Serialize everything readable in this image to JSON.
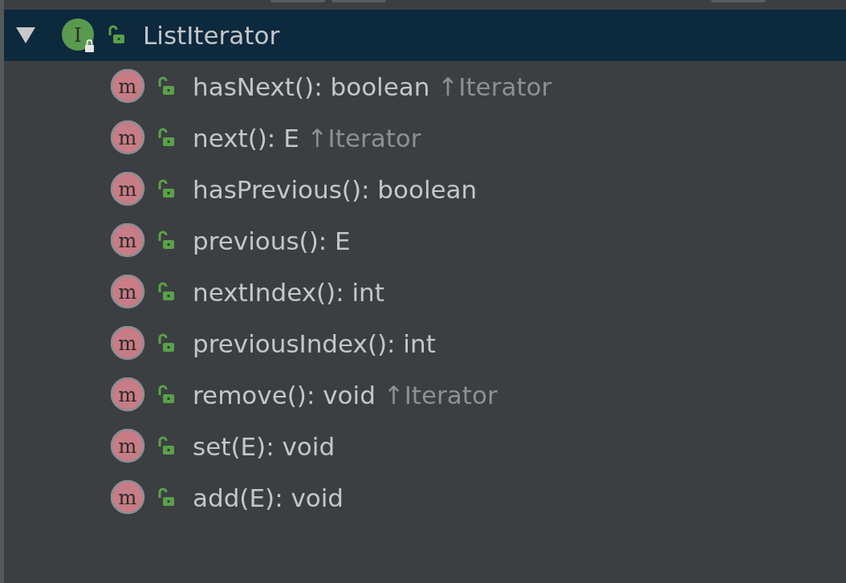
{
  "tree": {
    "label": "ListIterator",
    "icon_letter": "I",
    "selected": true,
    "expanded": true,
    "children": [
      {
        "signature": "hasNext(): boolean",
        "inherited": "↑Iterator",
        "icon_letter": "m",
        "selected": false
      },
      {
        "signature": "next(): E",
        "inherited": "↑Iterator",
        "icon_letter": "m",
        "selected": false
      },
      {
        "signature": "hasPrevious(): boolean",
        "icon_letter": "m",
        "selected": false
      },
      {
        "signature": "previous(): E",
        "icon_letter": "m",
        "selected": false
      },
      {
        "signature": "nextIndex(): int",
        "icon_letter": "m",
        "selected": false
      },
      {
        "signature": "previousIndex(): int",
        "icon_letter": "m",
        "selected": false
      },
      {
        "signature": "remove(): void",
        "inherited": "↑Iterator",
        "icon_letter": "m",
        "selected": false
      },
      {
        "signature": "set(E): void",
        "icon_letter": "m",
        "selected": false
      },
      {
        "signature": "add(E): void",
        "icon_letter": "m",
        "selected": false
      }
    ]
  }
}
